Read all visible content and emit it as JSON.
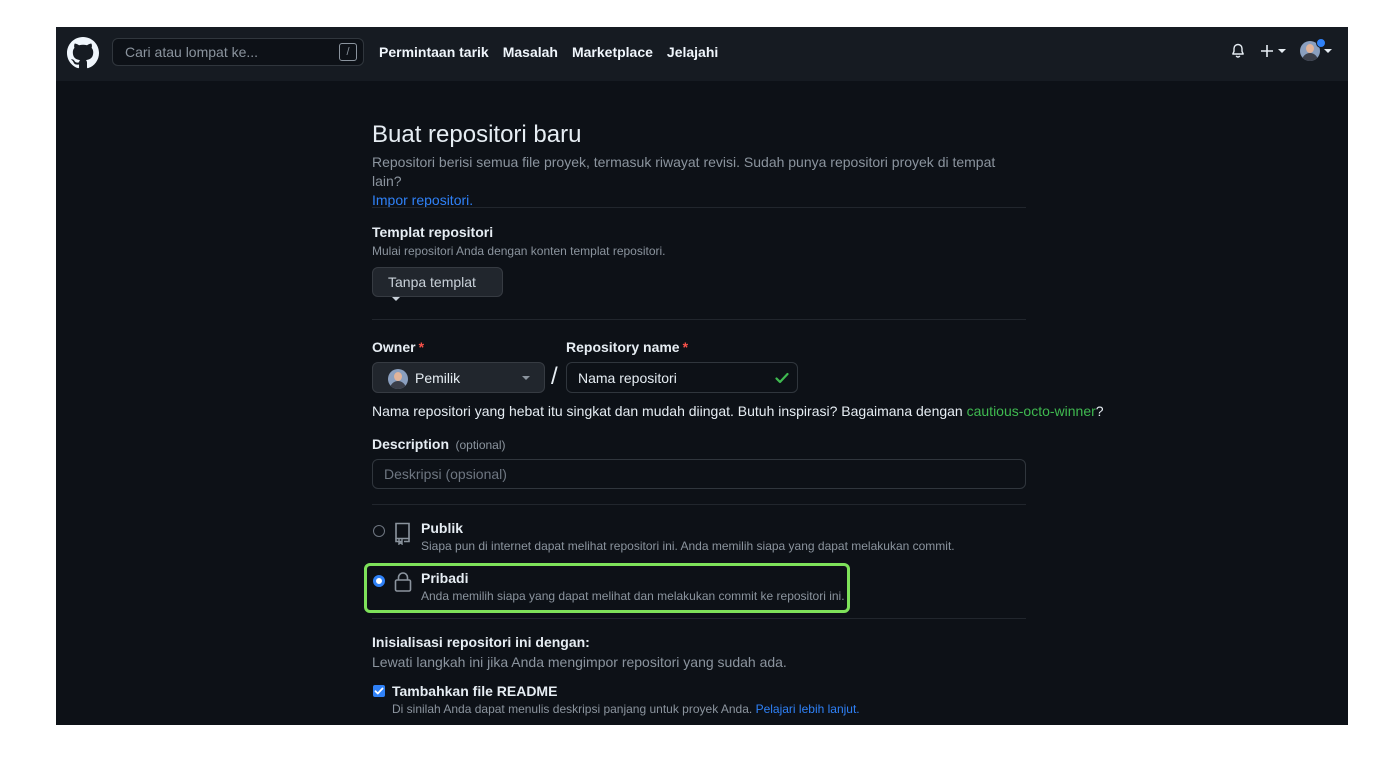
{
  "header": {
    "search_placeholder": "Cari atau lompat ke...",
    "search_shortcut": "/",
    "nav": [
      "Permintaan tarik",
      "Masalah",
      "Marketplace",
      "Jelajahi"
    ],
    "plus_label": "+"
  },
  "page": {
    "title": "Buat repositori baru",
    "subtitle": "Repositori berisi semua file proyek, termasuk riwayat revisi. Sudah punya repositori proyek di tempat lain?",
    "import_link": "Impor repositori."
  },
  "template": {
    "label": "Templat repositori",
    "note": "Mulai repositori Anda dengan konten templat repositori.",
    "button": "Tanpa templat"
  },
  "owner": {
    "label": "Owner",
    "required": "*",
    "value": "Pemilik"
  },
  "repo": {
    "label": "Repository name",
    "required": "*",
    "value": "Nama repositori",
    "separator": "/",
    "hint_prefix": "Nama repositori yang hebat itu singkat dan mudah diingat. Butuh inspirasi? Bagaimana dengan ",
    "hint_suggestion": "cautious-octo-winner",
    "hint_suffix": "?"
  },
  "description": {
    "label": "Description",
    "optional": "(optional)",
    "placeholder": "Deskripsi (opsional)"
  },
  "visibility": {
    "public": {
      "title": "Publik",
      "note": "Siapa pun di internet dapat melihat repositori ini. Anda memilih siapa yang dapat melakukan commit.",
      "selected": false
    },
    "private": {
      "title": "Pribadi",
      "note": "Anda memilih siapa yang dapat melihat dan melakukan commit ke repositori ini.",
      "selected": true
    }
  },
  "init": {
    "heading": "Inisialisasi repositori ini dengan:",
    "note": "Lewati langkah ini jika Anda mengimpor repositori yang sudah ada.",
    "readme_label": "Tambahkan file README",
    "readme_checked": true,
    "readme_note": "Di sinilah Anda dapat menulis deskripsi panjang untuk proyek Anda.",
    "readme_link": "Pelajari lebih lanjut."
  },
  "colors": {
    "accent": "#2f81f7",
    "success": "#3fb950",
    "focus": "#7ee25a",
    "background": "#0d1117"
  }
}
